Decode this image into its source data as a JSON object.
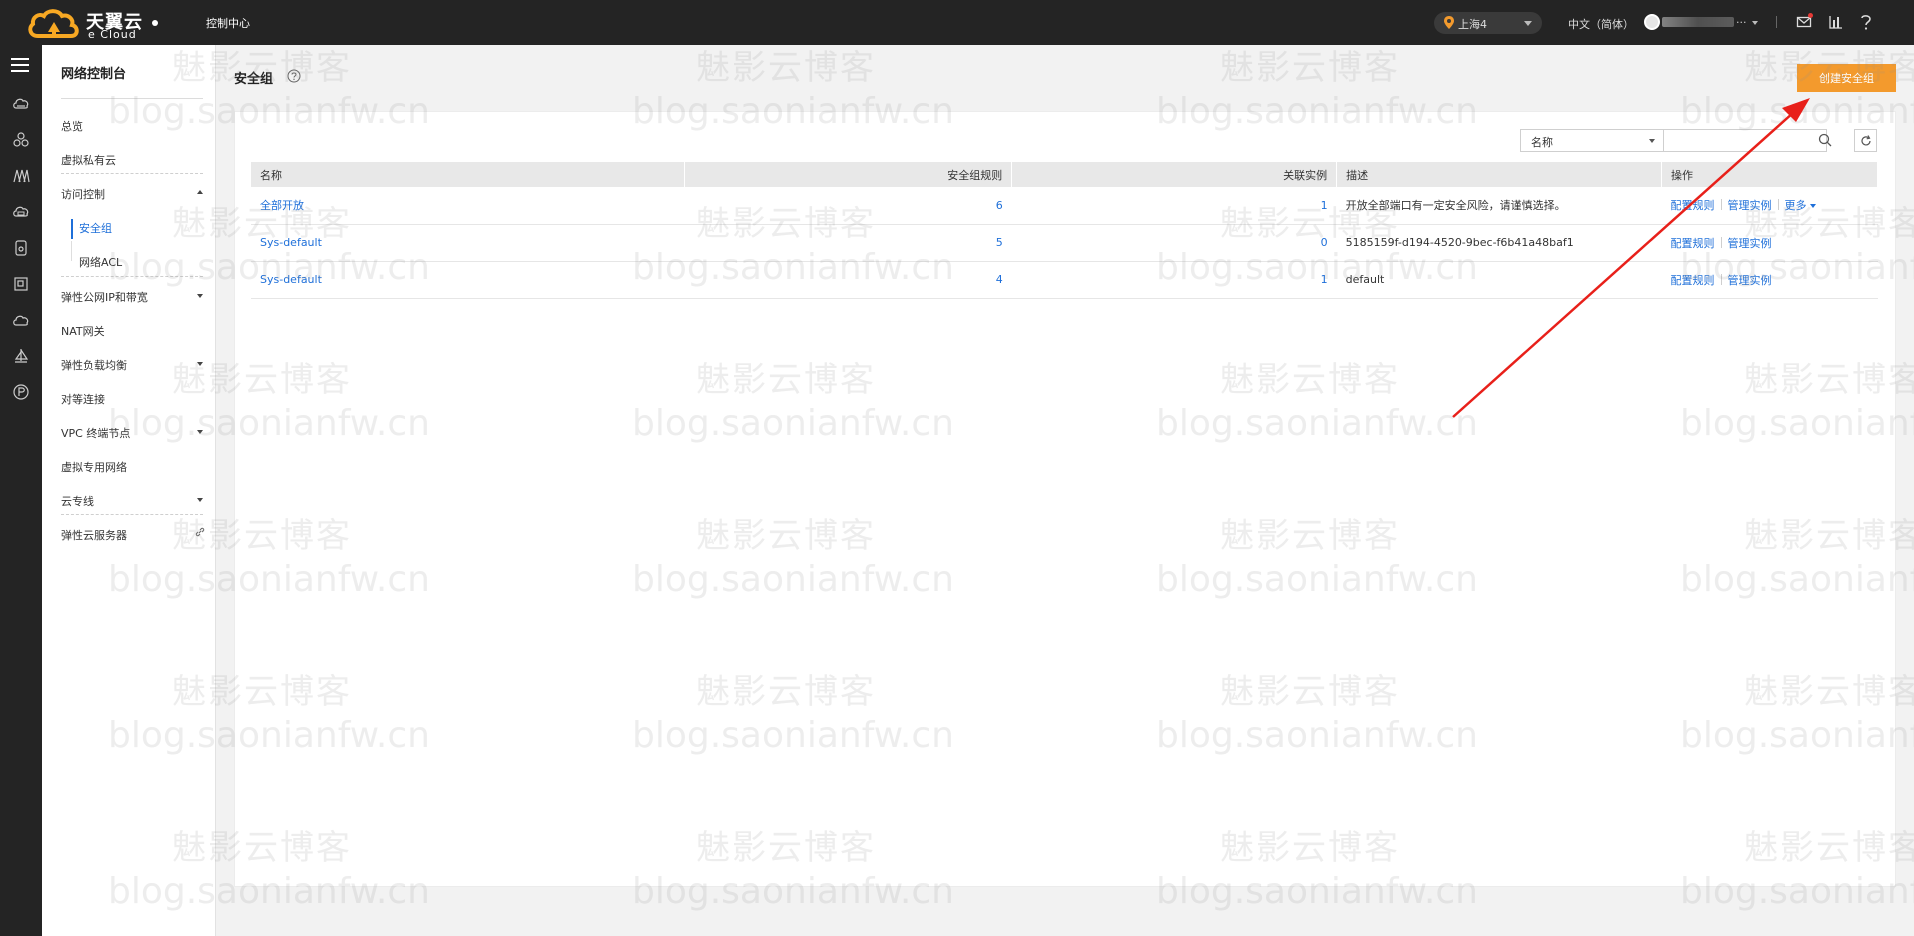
{
  "topbar": {
    "brand_cn": "天翼云",
    "brand_en": "e Cloud",
    "console": "控制中心",
    "region": "上海4",
    "language": "中文（简体）",
    "user_ellipsis": "...",
    "icons": [
      "mail-icon",
      "chart-icon",
      "help-icon"
    ]
  },
  "rail": {
    "icons": [
      "menu-icon",
      "cloud-server-icon",
      "network-icon",
      "storage-icon",
      "database-icon",
      "security-icon",
      "monitor-icon",
      "cloud-icon",
      "sail-icon",
      "parking-icon"
    ]
  },
  "sidebar": {
    "title": "网络控制台",
    "items": [
      {
        "label": "总览"
      },
      {
        "label": "虚拟私有云"
      },
      {
        "label": "访问控制"
      },
      {
        "label": "安全组"
      },
      {
        "label": "网络ACL"
      },
      {
        "label": "弹性公网IP和带宽"
      },
      {
        "label": "NAT网关"
      },
      {
        "label": "弹性负载均衡"
      },
      {
        "label": "对等连接"
      },
      {
        "label": "VPC 终端节点"
      },
      {
        "label": "虚拟专用网络"
      },
      {
        "label": "云专线"
      },
      {
        "label": "弹性云服务器"
      }
    ]
  },
  "main": {
    "title": "安全组",
    "create_button": "创建安全组",
    "search": {
      "field": "名称",
      "placeholder": ""
    },
    "table": {
      "headers": [
        "名称",
        "安全组规则",
        "关联实例",
        "描述",
        "操作"
      ],
      "rows": [
        {
          "name": "全部开放",
          "rules": "6",
          "instances": "1",
          "desc": "开放全部端口有一定安全风险，请谨慎选择。",
          "ops": [
            "配置规则",
            "管理实例",
            "更多"
          ]
        },
        {
          "name": "Sys-default",
          "rules": "5",
          "instances": "0",
          "desc": "5185159f-d194-4520-9bec-f6b41a48baf1",
          "ops": [
            "配置规则",
            "管理实例"
          ]
        },
        {
          "name": "Sys-default",
          "rules": "4",
          "instances": "1",
          "desc": "default",
          "ops": [
            "配置规则",
            "管理实例"
          ]
        }
      ]
    }
  },
  "watermark": {
    "cn": "魅影云博客",
    "en": "blog.saonianfw.cn"
  },
  "colors": {
    "topbar": "#242424",
    "accent": "#f39a2d",
    "link": "#1e6fd9",
    "annotation_arrow": "#e8201a"
  }
}
